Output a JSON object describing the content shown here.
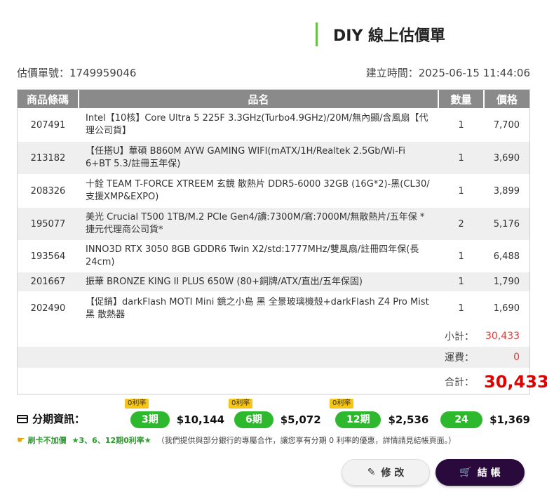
{
  "header": {
    "title": "DIY 線上估價單"
  },
  "meta": {
    "quote_no": "估價單號：1749959046",
    "created": "建立時間：2025-06-15 11:44:06"
  },
  "table": {
    "columns": [
      "商品條碼",
      "品名",
      "數量",
      "價格"
    ],
    "rows": [
      {
        "code": "207491",
        "name": "Intel【10核】Core Ultra 5 225F 3.3GHz(Turbo4.9GHz)/20M/無內顯/含風扇【代理公司貨】",
        "qty": "1",
        "price": "7,700"
      },
      {
        "code": "213182",
        "name": "【任搭U】華碩 B860M AYW GAMING WIFI(mATX/1H/Realtek 2.5Gb/Wi-Fi 6+BT 5.3/註冊五年保)",
        "qty": "1",
        "price": "3,690"
      },
      {
        "code": "208326",
        "name": "十銓 TEAM T-FORCE XTREEM 玄鏡 散熱片 DDR5-6000 32GB (16G*2)-黑(CL30/支援XMP&EXPO)",
        "qty": "1",
        "price": "3,899"
      },
      {
        "code": "195077",
        "name": "美光 Crucial T500 1TB/M.2 PCIe Gen4/讀:7300M/寫:7000M/無散熱片/五年保 *捷元代理商公司貨*",
        "qty": "2",
        "price": "5,176"
      },
      {
        "code": "193564",
        "name": "INNO3D RTX 3050 8GB GDDR6 Twin X2/std:1777MHz/雙風扇/註冊四年保(長24cm)",
        "qty": "1",
        "price": "6,488"
      },
      {
        "code": "201667",
        "name": "振華 BRONZE KING II PLUS 650W (80+銅牌/ATX/直出/五年保固)",
        "qty": "1",
        "price": "1,790"
      },
      {
        "code": "202490",
        "name": "【促銷】darkFlash MOTI Mini 鏡之小島 黑 全景玻璃機殼+darkFlash Z4 Pro Mist 黑 散熱器",
        "qty": "1",
        "price": "1,690"
      }
    ],
    "subtotal_label": "小計：",
    "subtotal": "30,433",
    "shipping_label": "運費：",
    "shipping": "0",
    "total_label": "合計：",
    "total": "30,433"
  },
  "installment": {
    "title": "分期資訊：",
    "plans": [
      {
        "badge": "0利率",
        "term": "3期",
        "amount": "$10,144"
      },
      {
        "badge": "0利率",
        "term": "6期",
        "amount": "$5,072"
      },
      {
        "badge": "0利率",
        "term": "12期",
        "amount": "$2,536"
      },
      {
        "badge": "",
        "term": "24期",
        "amount": "$1,369"
      }
    ]
  },
  "note": {
    "tag": "刷卡不加價",
    "highlight": "★3、6、12期0利率★",
    "text": "（我們提供與部分銀行的專屬合作，讓您享有分期 0 利率的優惠，詳情請見結帳頁面。）"
  },
  "buttons": {
    "edit": "修 改",
    "checkout": "結 帳"
  },
  "colors": {
    "accent_green": "#2db82d",
    "price_red": "#e00000",
    "checkout_bg": "#2a0a3d"
  }
}
